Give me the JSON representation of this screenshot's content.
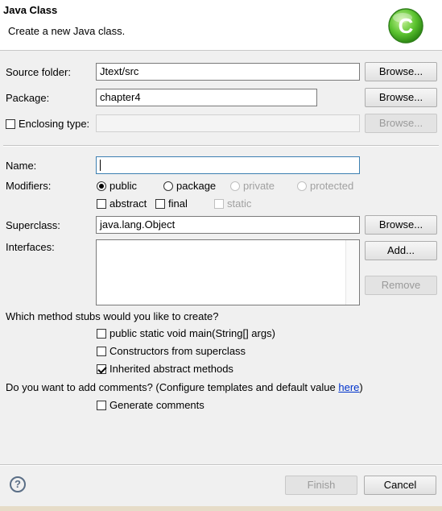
{
  "banner": {
    "title": "Java Class",
    "description": "Create a new Java class.",
    "logo_letter": "C"
  },
  "source_folder": {
    "label": "Source folder:",
    "value": "Jtext/src",
    "browse": "Browse..."
  },
  "package": {
    "label": "Package:",
    "value": "chapter4",
    "browse": "Browse..."
  },
  "enclosing_type": {
    "label": "Enclosing type:",
    "value": "",
    "browse": "Browse...",
    "checked": false
  },
  "name": {
    "label": "Name:",
    "value": ""
  },
  "modifiers": {
    "label": "Modifiers:",
    "public": "public",
    "package": "package",
    "private": "private",
    "protected": "protected",
    "selected": "public",
    "abstract": "abstract",
    "final": "final",
    "static": "static"
  },
  "superclass": {
    "label": "Superclass:",
    "value": "java.lang.Object",
    "browse": "Browse..."
  },
  "interfaces": {
    "label": "Interfaces:",
    "add": "Add...",
    "remove": "Remove",
    "items": []
  },
  "stubs": {
    "question": "Which method stubs would you like to create?",
    "main": "public static void main(String[] args)",
    "constructors": "Constructors from superclass",
    "inherited": "Inherited abstract methods",
    "inherited_checked": true
  },
  "comments": {
    "question_prefix": "Do you want to add comments? (Configure templates and default value ",
    "link": "here",
    "question_suffix": ")",
    "generate": "Generate comments"
  },
  "footer": {
    "help": "?",
    "finish": "Finish",
    "cancel": "Cancel"
  },
  "colors": {
    "accent": "#44b82c",
    "link": "#0033cc",
    "disabled_text": "#9a9a9a"
  }
}
